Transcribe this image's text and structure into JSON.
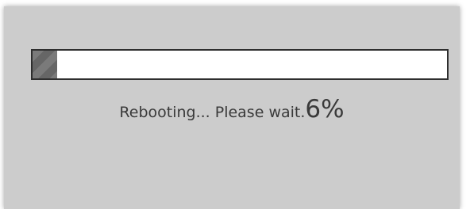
{
  "reboot_dialog": {
    "status_message": "Rebooting... Please wait.",
    "progress_percent_label": "6%",
    "progress_value": 0.06
  },
  "colors": {
    "dialog_background": "#cccccc",
    "track_border": "#2e2e2e",
    "fill": "#707070",
    "text": "#3a3a3a"
  }
}
